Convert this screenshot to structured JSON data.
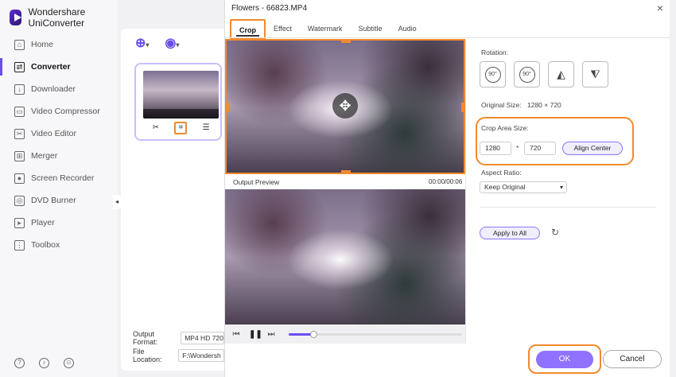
{
  "app": {
    "name": "Wondershare UniConverter"
  },
  "sidebar": {
    "items": [
      {
        "label": "Home",
        "icon": "home-icon"
      },
      {
        "label": "Converter",
        "icon": "converter-icon",
        "active": true
      },
      {
        "label": "Downloader",
        "icon": "downloader-icon"
      },
      {
        "label": "Video Compressor",
        "icon": "compress-icon"
      },
      {
        "label": "Video Editor",
        "icon": "scissors-icon"
      },
      {
        "label": "Merger",
        "icon": "merge-icon"
      },
      {
        "label": "Screen Recorder",
        "icon": "record-icon"
      },
      {
        "label": "DVD Burner",
        "icon": "disc-icon"
      },
      {
        "label": "Player",
        "icon": "play-icon"
      },
      {
        "label": "Toolbox",
        "icon": "grid-icon"
      }
    ]
  },
  "main": {
    "output_format_label": "Output Format:",
    "output_format_value": "MP4 HD 720",
    "file_location_label": "File Location:",
    "file_location_value": "F:\\Wondersh"
  },
  "dialog": {
    "title": "Flowers - 66823.MP4",
    "tabs": [
      "Crop",
      "Effect",
      "Watermark",
      "Subtitle",
      "Audio"
    ],
    "output_preview_label": "Output Preview",
    "time": "00:00/00:06",
    "playback_progress": 0.14,
    "rotation_label": "Rotation:",
    "rotate_cw_label": "90°",
    "rotate_ccw_label": "90°",
    "original_size_label": "Original Size:",
    "original_size_value": "1280 × 720",
    "crop_area_label": "Crop Area Size:",
    "crop_width": "1280",
    "crop_separator": "*",
    "crop_height": "720",
    "align_center": "Align Center",
    "aspect_ratio_label": "Aspect Ratio:",
    "aspect_ratio_value": "Keep Original",
    "apply_to_all": "Apply to All",
    "ok": "OK",
    "cancel": "Cancel"
  },
  "colors": {
    "accent": "#6b4df0",
    "highlight": "#f28a2e",
    "ok_button": "#8f72ff"
  }
}
